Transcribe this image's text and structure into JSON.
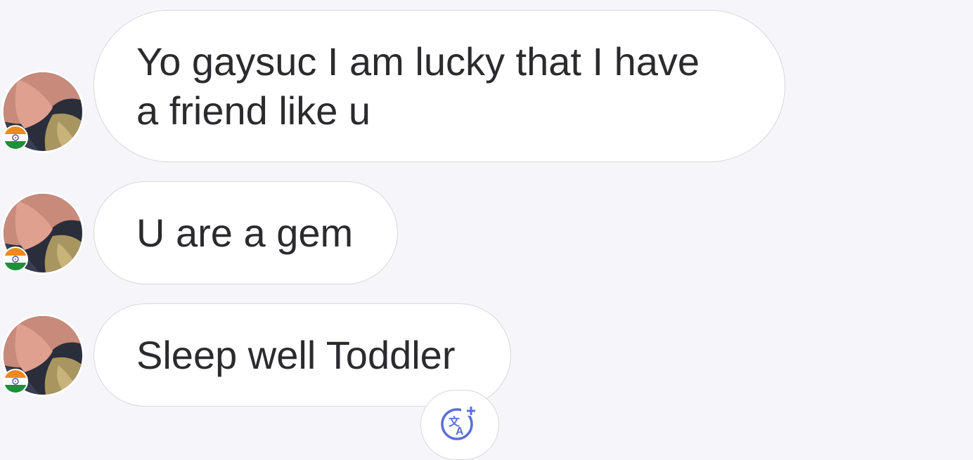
{
  "conversation": {
    "messages": [
      {
        "text": "Yo gaysuc I am lucky that I have\na friend like u",
        "sender_avatar": "user-avatar-photo",
        "sender_flag": "india-flag"
      },
      {
        "text": "U are a gem",
        "sender_avatar": "user-avatar-photo",
        "sender_flag": "india-flag"
      },
      {
        "text": "Sleep well Toddler",
        "sender_avatar": "user-avatar-photo",
        "sender_flag": "india-flag"
      }
    ],
    "translate_button": {
      "icon": "translate-icon"
    }
  },
  "colors": {
    "background": "#f5f5fa",
    "bubble_background": "#ffffff",
    "bubble_border": "#d8d8dd",
    "text": "#2b2b2e",
    "translate_icon": "#5b6fd6",
    "flag_saffron": "#f28a1b",
    "flag_green": "#1e8f3a",
    "flag_chakra": "#2a3a8c"
  }
}
